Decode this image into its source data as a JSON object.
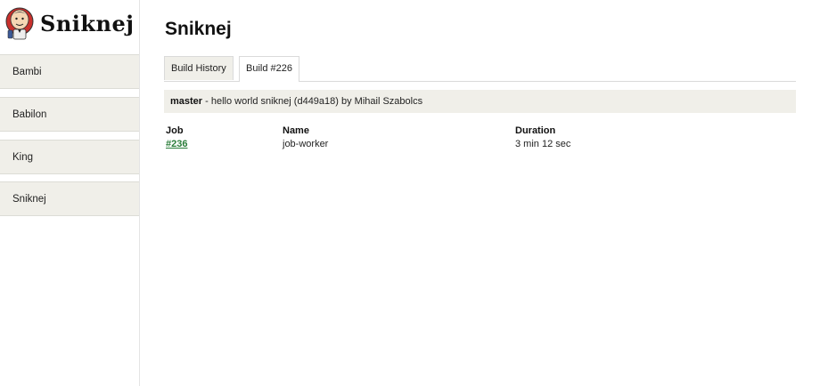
{
  "app": {
    "logo_text": "Sniknej",
    "logo_icon": "butler-icon"
  },
  "sidebar": {
    "projects": [
      {
        "label": "Bambi"
      },
      {
        "label": "Babilon"
      },
      {
        "label": "King"
      },
      {
        "label": "Sniknej"
      }
    ]
  },
  "main": {
    "title": "Sniknej",
    "tabs": [
      {
        "label": "Build History",
        "active": false
      },
      {
        "label": "Build #226",
        "active": true
      }
    ],
    "commit": {
      "branch": "master",
      "message": " - hello world sniknej (d449a18) by Mihail Szabolcs"
    },
    "jobs_table": {
      "headers": {
        "job": "Job",
        "name": "Name",
        "duration": "Duration"
      },
      "rows": [
        {
          "job": "#236",
          "name": "job-worker",
          "duration": "3 min 12 sec"
        }
      ]
    }
  },
  "colors": {
    "accent_link": "#2a7d3a",
    "panel_bg": "#f0efe9"
  }
}
